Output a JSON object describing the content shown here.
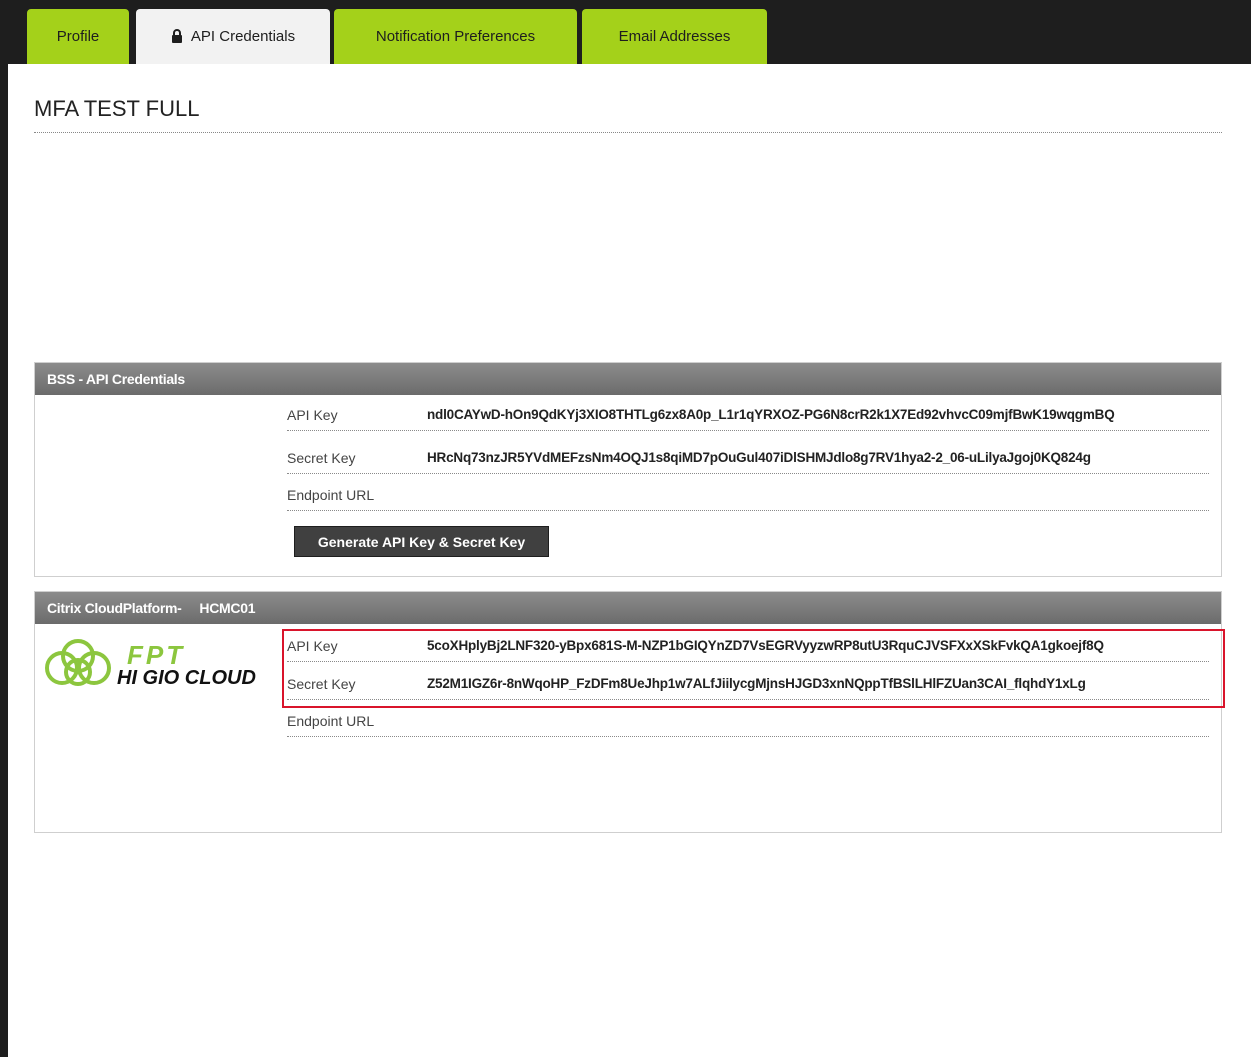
{
  "tabs": [
    {
      "label": "Profile"
    },
    {
      "label": "API Credentials",
      "icon": "lock-icon"
    },
    {
      "label": "Notification Preferences"
    },
    {
      "label": "Email Addresses"
    }
  ],
  "active_tab": "API Credentials",
  "page_title": "MFA TEST FULL",
  "bss_panel": {
    "title": "BSS - API Credentials",
    "api_key_label": "API Key",
    "api_key_value": "ndl0CAYwD-hOn9QdKYj3XIO8THTLg6zx8A0p_L1r1qYRXOZ-PG6N8crR2k1X7Ed92vhvcC09mjfBwK19wqgmBQ",
    "secret_key_label": "Secret Key",
    "secret_key_value": "HRcNq73nzJR5YVdMEFzsNm4OQJ1s8qiMD7pOuGul407iDlSHMJdlo8g7RV1hya2-2_06-uLilyaJgoj0KQ824g",
    "endpoint_label": "Endpoint URL",
    "endpoint_value": "",
    "generate_button": "Generate API Key & Secret Key"
  },
  "citrix_panel": {
    "title": "Citrix CloudPlatform-     HCMC01",
    "logo": {
      "brand": "FPT",
      "product": "HI GIO CLOUD"
    },
    "api_key_label": "API Key",
    "api_key_value": "5coXHplyBj2LNF320-yBpx681S-M-NZP1bGIQYnZD7VsEGRVyyzwRP8utU3RquCJVSFXxXSkFvkQA1gkoejf8Q",
    "secret_key_label": "Secret Key",
    "secret_key_value": "Z52M1IGZ6r-8nWqoHP_FzDFm8UeJhp1w7ALfJiilycgMjnsHJGD3xnNQppTfBSlLHlFZUan3CAI_flqhdY1xLg",
    "endpoint_label": "Endpoint URL",
    "endpoint_value": ""
  },
  "colors": {
    "tab_green": "#a4d11a",
    "active_tab": "#f2f2f2",
    "highlight_red": "#d9142b",
    "header_gray": "#7a7a7a"
  }
}
